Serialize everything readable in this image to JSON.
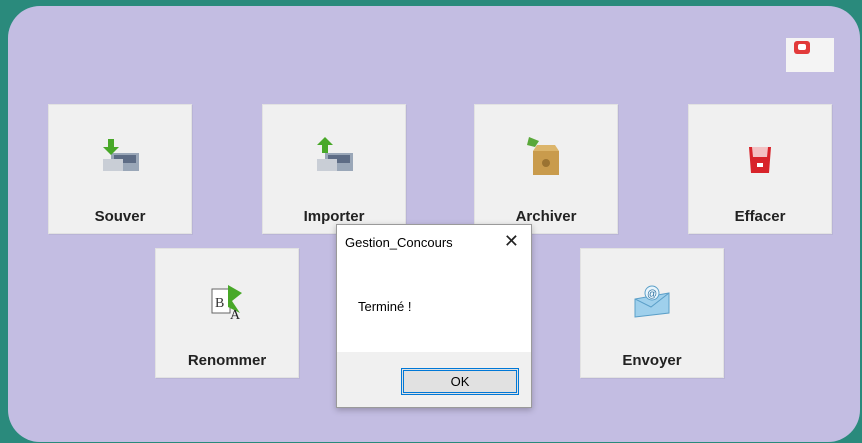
{
  "buttons": {
    "save": "Souver",
    "import": "Importer",
    "archive": "Archiver",
    "erase": "Effacer",
    "rename": "Renommer",
    "send": "Envoyer"
  },
  "dialog": {
    "title": "Gestion_Concours",
    "close_glyph": "✕",
    "message": "Terminé !",
    "ok_label": "OK"
  },
  "colors": {
    "outer_bg": "#2a8a7c",
    "panel_bg": "#c3bde2",
    "accent": "#0078d7"
  },
  "icons": {
    "save": "download-disk-icon",
    "import": "upload-disk-icon",
    "archive": "archive-box-icon",
    "erase": "trash-bin-icon",
    "rename": "rename-icon",
    "send": "email-envelope-icon",
    "close": "power-off-icon"
  }
}
